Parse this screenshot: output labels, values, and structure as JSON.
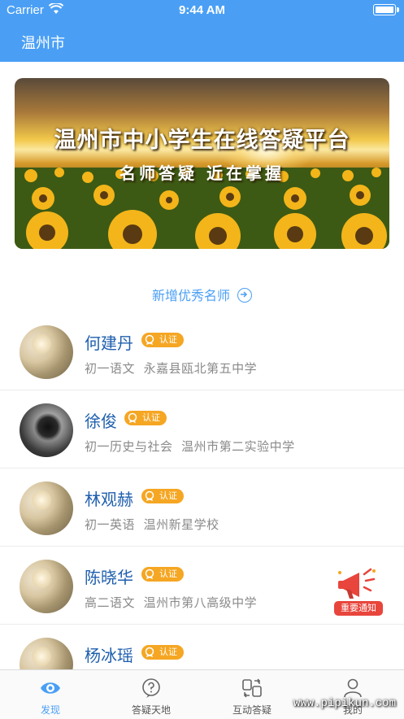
{
  "status_bar": {
    "carrier": "Carrier",
    "time": "9:44 AM"
  },
  "nav": {
    "city": "温州市"
  },
  "banner": {
    "title": "温州市中小学生在线答疑平台",
    "subtitle": "名师答疑 近在掌握"
  },
  "section": {
    "link_label": "新增优秀名师"
  },
  "teachers": [
    {
      "name": "何建丹",
      "badge": "认证",
      "subject": "初一语文",
      "school": "永嘉县瓯北第五中学",
      "avatar": "sunflower-photo"
    },
    {
      "name": "徐俊",
      "badge": "认证",
      "subject": "初一历史与社会",
      "school": "温州市第二实验中学",
      "avatar": "dark-flower-photo"
    },
    {
      "name": "林观赫",
      "badge": "认证",
      "subject": "初一英语",
      "school": "温州新星学校",
      "avatar": "sunflower-photo"
    },
    {
      "name": "陈晓华",
      "badge": "认证",
      "subject": "高二语文",
      "school": "温州市第八高级中学",
      "avatar": "sunflower-photo"
    },
    {
      "name": "杨冰瑶",
      "badge": "认证",
      "subject": "",
      "school": "",
      "avatar": "sunflower-photo"
    }
  ],
  "floating_notice": {
    "label": "重要通知",
    "icon": "megaphone-icon"
  },
  "tabs": [
    {
      "label": "发现",
      "icon": "eye-icon",
      "active": true
    },
    {
      "label": "答疑天地",
      "icon": "question-icon",
      "active": false
    },
    {
      "label": "互动答疑",
      "icon": "exchange-icon",
      "active": false
    },
    {
      "label": "我的",
      "icon": "user-icon",
      "active": false
    }
  ],
  "watermark": "www.pipikun.com",
  "colors": {
    "primary": "#4a9ff5",
    "name": "#1f5fae",
    "badge": "#f5a623",
    "notice": "#e8453c"
  }
}
